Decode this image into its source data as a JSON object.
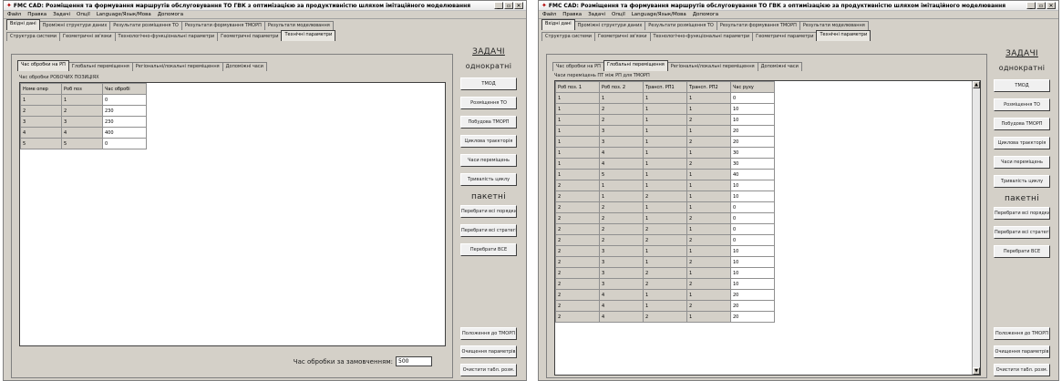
{
  "app": {
    "title": "FMC CAD: Розміщення та формування маршрутів обслуговування ТО ГВК з оптимізацією за продуктивністю шляхом імітаційного моделювання",
    "menu": [
      "Файл",
      "Правка",
      "Задачі",
      "Опції",
      "Language/Язык/Мова",
      "Допомога"
    ]
  },
  "main_tabs": [
    "Вхідні дані",
    "Проміжні структури даних",
    "Результати розміщення ТО",
    "Результати формування ТМОРП",
    "Результати моделювання"
  ],
  "sub_tabs": [
    "Структура системи",
    "Геометричні зв'язки",
    "Технологічно-функціональні параметри",
    "Геометричні параметри",
    "Технічні параметри"
  ],
  "inner_tabs": [
    "Час обробки на РП",
    "Глобальні переміщення",
    "Регіональні/локальні переміщення",
    "Допоміжні часи"
  ],
  "left": {
    "grid_caption": "Час обробки РОБОЧИХ ПОЗИЦІЯХ",
    "columns": [
      "Номе опер",
      "Роб поз",
      "Час обробі"
    ],
    "rows": [
      [
        "1",
        "1",
        "0"
      ],
      [
        "2",
        "2",
        "230"
      ],
      [
        "3",
        "3",
        "230"
      ],
      [
        "4",
        "4",
        "400"
      ],
      [
        "5",
        "5",
        "0"
      ]
    ],
    "bottom_label": "Час обробки за замовченням:",
    "bottom_value": "500"
  },
  "right": {
    "grid_caption": "Часи переміщень ПТ між РП для ТМОРП",
    "columns": [
      "Роб поз. 1",
      "Роб поз. 2",
      "Трансп. РП1",
      "Трансп. РП2",
      "Час руху"
    ],
    "rows": [
      [
        "1",
        "1",
        "1",
        "1",
        "0"
      ],
      [
        "1",
        "2",
        "1",
        "1",
        "10"
      ],
      [
        "1",
        "2",
        "1",
        "2",
        "10"
      ],
      [
        "1",
        "3",
        "1",
        "1",
        "20"
      ],
      [
        "1",
        "3",
        "1",
        "2",
        "20"
      ],
      [
        "1",
        "4",
        "1",
        "1",
        "30"
      ],
      [
        "1",
        "4",
        "1",
        "2",
        "30"
      ],
      [
        "1",
        "5",
        "1",
        "1",
        "40"
      ],
      [
        "2",
        "1",
        "1",
        "1",
        "10"
      ],
      [
        "2",
        "1",
        "2",
        "1",
        "10"
      ],
      [
        "2",
        "2",
        "1",
        "1",
        "0"
      ],
      [
        "2",
        "2",
        "1",
        "2",
        "0"
      ],
      [
        "2",
        "2",
        "2",
        "1",
        "0"
      ],
      [
        "2",
        "2",
        "2",
        "2",
        "0"
      ],
      [
        "2",
        "3",
        "1",
        "1",
        "10"
      ],
      [
        "2",
        "3",
        "1",
        "2",
        "10"
      ],
      [
        "2",
        "3",
        "2",
        "1",
        "10"
      ],
      [
        "2",
        "3",
        "2",
        "2",
        "10"
      ],
      [
        "2",
        "4",
        "1",
        "1",
        "20"
      ],
      [
        "2",
        "4",
        "1",
        "2",
        "20"
      ],
      [
        "2",
        "4",
        "2",
        "1",
        "20"
      ]
    ]
  },
  "sidebar": {
    "group1_title": "ЗАДАЧІ",
    "group1_subtitle": "однократні",
    "group1_buttons": [
      "ТМОД",
      "Розміщення ТО",
      "Побудова ТМОРП",
      "Циклова траєкторія",
      "Часи переміщень",
      "Тривалість циклу"
    ],
    "group2_title": "пакетні",
    "group2_buttons": [
      "Перебрати всі порядки",
      "Перебрати всі стратегії",
      "Перебрати ВСЕ"
    ],
    "bottom_buttons": [
      "Положення до ТМОРП",
      "Очищення параметрів",
      "Очистити табл. розм."
    ]
  }
}
